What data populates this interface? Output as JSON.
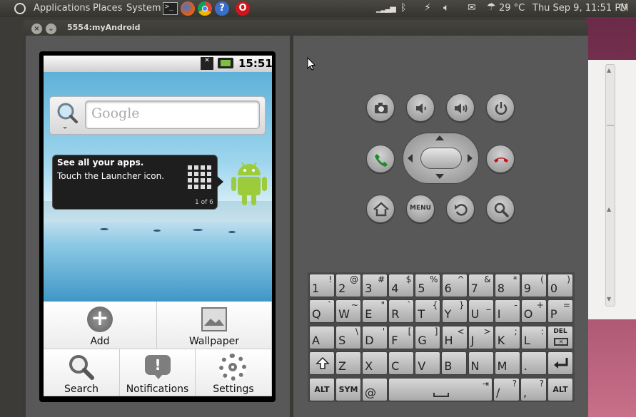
{
  "panel": {
    "applications": "Applications",
    "places": "Places",
    "system": "System",
    "weather": "29 °C",
    "clock": "Thu Sep  9, 11:51 PM"
  },
  "window": {
    "title": "5554:myAndroid"
  },
  "phone": {
    "status_time": "15:51",
    "search_placeholder": "Google",
    "tip_title": "See all your apps.",
    "tip_body": "Touch the Launcher icon.",
    "tip_page": "1 of 6",
    "menu": {
      "add": "Add",
      "wallpaper": "Wallpaper",
      "search": "Search",
      "notifications": "Notifications",
      "settings": "Settings"
    }
  },
  "controls": {
    "menu_label": "MENU"
  },
  "keyboard": {
    "row1": [
      {
        "m": "1",
        "a": "!"
      },
      {
        "m": "2",
        "a": "@"
      },
      {
        "m": "3",
        "a": "#"
      },
      {
        "m": "4",
        "a": "$"
      },
      {
        "m": "5",
        "a": "%"
      },
      {
        "m": "6",
        "a": "^"
      },
      {
        "m": "7",
        "a": "&"
      },
      {
        "m": "8",
        "a": "*"
      },
      {
        "m": "9",
        "a": "("
      },
      {
        "m": "0",
        "a": ")"
      }
    ],
    "row2": [
      {
        "m": "Q",
        "a": "`"
      },
      {
        "m": "W",
        "a": "~"
      },
      {
        "m": "E",
        "a": "\""
      },
      {
        "m": "R",
        "a": "`"
      },
      {
        "m": "T",
        "a": "{"
      },
      {
        "m": "Y",
        "a": "}"
      },
      {
        "m": "U",
        "a": "_"
      },
      {
        "m": "I",
        "a": "-"
      },
      {
        "m": "O",
        "a": "+"
      },
      {
        "m": "P",
        "a": "="
      }
    ],
    "row3": [
      {
        "m": "A",
        "a": ""
      },
      {
        "m": "S",
        "a": "\\"
      },
      {
        "m": "D",
        "a": "'"
      },
      {
        "m": "F",
        "a": "["
      },
      {
        "m": "G",
        "a": "]"
      },
      {
        "m": "H",
        "a": "<"
      },
      {
        "m": "J",
        "a": ">"
      },
      {
        "m": "K",
        "a": ";"
      },
      {
        "m": "L",
        "a": ":"
      }
    ],
    "row4": [
      {
        "m": "Z",
        "a": ""
      },
      {
        "m": "X",
        "a": ""
      },
      {
        "m": "C",
        "a": ""
      },
      {
        "m": "V",
        "a": ""
      },
      {
        "m": "B",
        "a": ""
      },
      {
        "m": "N",
        "a": ""
      },
      {
        "m": "M",
        "a": ""
      },
      {
        "m": ".",
        "a": ""
      }
    ],
    "del": "DEL",
    "alt": "ALT",
    "sym": "SYM",
    "at": "@",
    "slash": "/",
    "slash_alt": "?",
    "comma": ",",
    "comma_alt": "?"
  }
}
